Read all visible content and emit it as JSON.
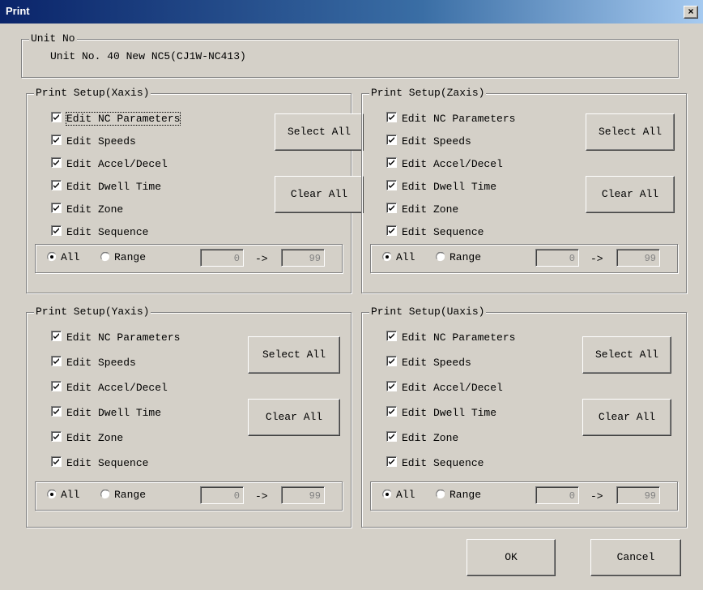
{
  "window": {
    "title": "Print",
    "close_label": "×"
  },
  "unit": {
    "legend": "Unit No",
    "value": "Unit No. 40 New NC5(CJ1W-NC413)"
  },
  "panels": [
    {
      "legend": "Print Setup(Xaxis)",
      "checkboxes": [
        "Edit NC Parameters",
        "Edit Speeds",
        "Edit Accel/Decel",
        "Edit Dwell Time",
        "Edit Zone",
        "Edit Sequence"
      ],
      "checked": [
        true,
        true,
        true,
        true,
        true,
        true
      ],
      "select_all": "Select All",
      "clear_all": "Clear All",
      "radio_all": "All",
      "radio_range": "Range",
      "selected": "All",
      "range_from": "0",
      "range_to": "99",
      "arrow": "->"
    },
    {
      "legend": "Print Setup(Zaxis)",
      "checkboxes": [
        "Edit NC Parameters",
        "Edit Speeds",
        "Edit Accel/Decel",
        "Edit Dwell Time",
        "Edit Zone",
        "Edit Sequence"
      ],
      "checked": [
        true,
        true,
        true,
        true,
        true,
        true
      ],
      "select_all": "Select All",
      "clear_all": "Clear All",
      "radio_all": "All",
      "radio_range": "Range",
      "selected": "All",
      "range_from": "0",
      "range_to": "99",
      "arrow": "->"
    },
    {
      "legend": "Print Setup(Yaxis)",
      "checkboxes": [
        "Edit NC Parameters",
        "Edit Speeds",
        "Edit Accel/Decel",
        "Edit Dwell Time",
        "Edit Zone",
        "Edit Sequence"
      ],
      "checked": [
        true,
        true,
        true,
        true,
        true,
        true
      ],
      "select_all": "Select All",
      "clear_all": "Clear All",
      "radio_all": "All",
      "radio_range": "Range",
      "selected": "All",
      "range_from": "0",
      "range_to": "99",
      "arrow": "->"
    },
    {
      "legend": "Print Setup(Uaxis)",
      "checkboxes": [
        "Edit NC Parameters",
        "Edit Speeds",
        "Edit Accel/Decel",
        "Edit Dwell Time",
        "Edit Zone",
        "Edit Sequence"
      ],
      "checked": [
        true,
        true,
        true,
        true,
        true,
        true
      ],
      "select_all": "Select All",
      "clear_all": "Clear All",
      "radio_all": "All",
      "radio_range": "Range",
      "selected": "All",
      "range_from": "0",
      "range_to": "99",
      "arrow": "->"
    }
  ],
  "buttons": {
    "ok": "OK",
    "cancel": "Cancel"
  }
}
